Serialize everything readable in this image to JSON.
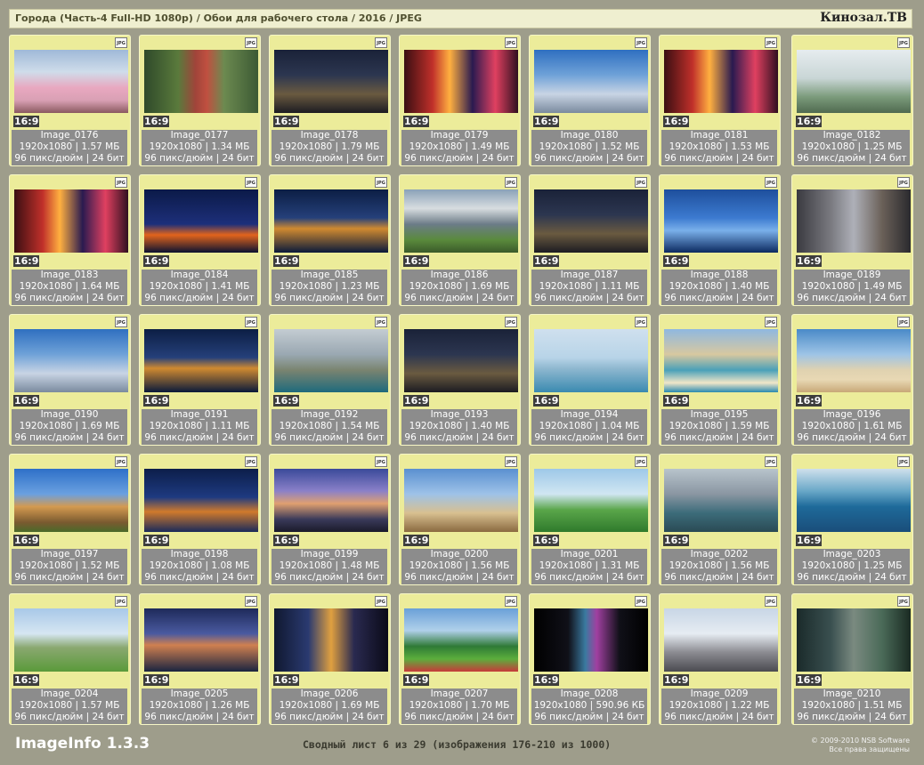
{
  "header": {
    "path": "Города (Часть-4 Full-HD 1080p) / Обои для рабочего стола / 2016 / JPEG",
    "brand": "Кинозал.ТВ"
  },
  "thumb_badge": "JPG",
  "images": [
    {
      "name": "Image_0176",
      "size": "1920x1080 | 1.57 МБ",
      "meta": "96 пикс/дюйм | 24 бит",
      "ratio": "16:9",
      "scene": "fuji"
    },
    {
      "name": "Image_0177",
      "size": "1920x1080 | 1.34 МБ",
      "meta": "96 пикс/дюйм | 24 бит",
      "ratio": "16:9",
      "scene": "pagoda"
    },
    {
      "name": "Image_0178",
      "size": "1920x1080 | 1.79 МБ",
      "meta": "96 пикс/дюйм | 24 бит",
      "ratio": "16:9",
      "scene": "nightcity"
    },
    {
      "name": "Image_0179",
      "size": "1920x1080 | 1.49 МБ",
      "meta": "96 пикс/дюйм | 24 бит",
      "ratio": "16:9",
      "scene": "neon"
    },
    {
      "name": "Image_0180",
      "size": "1920x1080 | 1.52 МБ",
      "meta": "96 пикс/дюйм | 24 бит",
      "ratio": "16:9",
      "scene": "bluecity"
    },
    {
      "name": "Image_0181",
      "size": "1920x1080 | 1.53 МБ",
      "meta": "96 пикс/дюйм | 24 бит",
      "ratio": "16:9",
      "scene": "neon"
    },
    {
      "name": "Image_0182",
      "size": "1920x1080 | 1.25 МБ",
      "meta": "96 пикс/дюйм | 24 бит",
      "ratio": "16:9",
      "scene": "daycity"
    },
    {
      "name": "Image_0183",
      "size": "1920x1080 | 1.64 МБ",
      "meta": "96 пикс/дюйм | 24 бит",
      "ratio": "16:9",
      "scene": "neon"
    },
    {
      "name": "Image_0184",
      "size": "1920x1080 | 1.41 МБ",
      "meta": "96 пикс/дюйм | 24 бит",
      "ratio": "16:9",
      "scene": "tower"
    },
    {
      "name": "Image_0185",
      "size": "1920x1080 | 1.23 МБ",
      "meta": "96 пикс/дюйм | 24 бит",
      "ratio": "16:9",
      "scene": "harbor"
    },
    {
      "name": "Image_0186",
      "size": "1920x1080 | 1.69 МБ",
      "meta": "96 пикс/дюйм | 24 бит",
      "ratio": "16:9",
      "scene": "mountain"
    },
    {
      "name": "Image_0187",
      "size": "1920x1080 | 1.11 МБ",
      "meta": "96 пикс/дюйм | 24 бит",
      "ratio": "16:9",
      "scene": "nightcity"
    },
    {
      "name": "Image_0188",
      "size": "1920x1080 | 1.40 МБ",
      "meta": "96 пикс/дюйм | 24 бит",
      "ratio": "16:9",
      "scene": "bridge"
    },
    {
      "name": "Image_0189",
      "size": "1920x1080 | 1.49 МБ",
      "meta": "96 пикс/дюйм | 24 бит",
      "ratio": "16:9",
      "scene": "street"
    },
    {
      "name": "Image_0190",
      "size": "1920x1080 | 1.69 МБ",
      "meta": "96 пикс/дюйм | 24 бит",
      "ratio": "16:9",
      "scene": "bluecity"
    },
    {
      "name": "Image_0191",
      "size": "1920x1080 | 1.11 МБ",
      "meta": "96 пикс/дюйм | 24 бит",
      "ratio": "16:9",
      "scene": "harbor"
    },
    {
      "name": "Image_0192",
      "size": "1920x1080 | 1.54 МБ",
      "meta": "96 пикс/дюйм | 24 бит",
      "ratio": "16:9",
      "scene": "marina"
    },
    {
      "name": "Image_0193",
      "size": "1920x1080 | 1.40 МБ",
      "meta": "96 пикс/дюйм | 24 бит",
      "ratio": "16:9",
      "scene": "nightcity"
    },
    {
      "name": "Image_0194",
      "size": "1920x1080 | 1.04 МБ",
      "meta": "96 пикс/дюйм | 24 бит",
      "ratio": "16:9",
      "scene": "seaskyline"
    },
    {
      "name": "Image_0195",
      "size": "1920x1080 | 1.59 МБ",
      "meta": "96 пикс/дюйм | 24 бит",
      "ratio": "16:9",
      "scene": "resort"
    },
    {
      "name": "Image_0196",
      "size": "1920x1080 | 1.61 МБ",
      "meta": "96 пикс/дюйм | 24 бит",
      "ratio": "16:9",
      "scene": "beach"
    },
    {
      "name": "Image_0197",
      "size": "1920x1080 | 1.52 МБ",
      "meta": "96 пикс/дюйм | 24 бит",
      "ratio": "16:9",
      "scene": "palace"
    },
    {
      "name": "Image_0198",
      "size": "1920x1080 | 1.08 МБ",
      "meta": "96 пикс/дюйм | 24 бит",
      "ratio": "16:9",
      "scene": "burj"
    },
    {
      "name": "Image_0199",
      "size": "1920x1080 | 1.48 МБ",
      "meta": "96 пикс/дюйм | 24 бит",
      "ratio": "16:9",
      "scene": "dusk"
    },
    {
      "name": "Image_0200",
      "size": "1920x1080 | 1.56 МБ",
      "meta": "96 пикс/дюйм | 24 бит",
      "ratio": "16:9",
      "scene": "towers"
    },
    {
      "name": "Image_0201",
      "size": "1920x1080 | 1.31 МБ",
      "meta": "96 пикс/дюйм | 24 бит",
      "ratio": "16:9",
      "scene": "park"
    },
    {
      "name": "Image_0202",
      "size": "1920x1080 | 1.56 МБ",
      "meta": "96 пикс/дюйм | 24 бит",
      "ratio": "16:9",
      "scene": "aerial"
    },
    {
      "name": "Image_0203",
      "size": "1920x1080 | 1.25 МБ",
      "meta": "96 пикс/дюйм | 24 бит",
      "ratio": "16:9",
      "scene": "palm"
    },
    {
      "name": "Image_0204",
      "size": "1920x1080 | 1.57 МБ",
      "meta": "96 пикс/дюйм | 24 бит",
      "ratio": "16:9",
      "scene": "lawn"
    },
    {
      "name": "Image_0205",
      "size": "1920x1080 | 1.26 МБ",
      "meta": "96 пикс/дюйм | 24 бит",
      "ratio": "16:9",
      "scene": "atlantis"
    },
    {
      "name": "Image_0206",
      "size": "1920x1080 | 1.69 МБ",
      "meta": "96 пикс/дюйм | 24 бит",
      "ratio": "16:9",
      "scene": "road"
    },
    {
      "name": "Image_0207",
      "size": "1920x1080 | 1.70 МБ",
      "meta": "96 пикс/дюйм | 24 бит",
      "ratio": "16:9",
      "scene": "garden"
    },
    {
      "name": "Image_0208",
      "size": "1920x1080 | 590.96 КБ",
      "meta": "96 пикс/дюйм | 24 бит",
      "ratio": "16:9",
      "scene": "dark"
    },
    {
      "name": "Image_0209",
      "size": "1920x1080 | 1.22 МБ",
      "meta": "96 пикс/дюйм | 24 бит",
      "ratio": "16:9",
      "scene": "burjday"
    },
    {
      "name": "Image_0210",
      "size": "1920x1080 | 1.51 МБ",
      "meta": "96 пикс/дюйм | 24 бит",
      "ratio": "16:9",
      "scene": "villa"
    }
  ],
  "footer": {
    "app": "ImageInfo 1.3.3",
    "summary": "Сводный лист 6 из 29 (изображения 176-210 из 1000)",
    "copyright_line1": "© 2009-2010 NSB Software",
    "copyright_line2": "Все права защищены"
  },
  "colors": {
    "background": "#9e9d8b",
    "card": "#ecec9a",
    "info_panel": "#8c8c8c"
  }
}
